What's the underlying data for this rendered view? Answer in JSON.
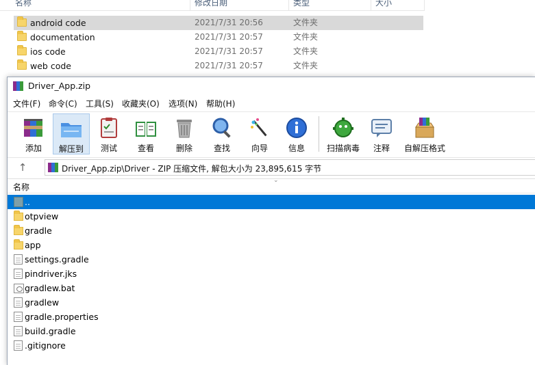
{
  "explorer": {
    "headers": {
      "name": "名称",
      "date": "修改日期",
      "type": "类型",
      "size": "大小"
    },
    "rows": [
      {
        "name": "android code",
        "date": "2021/7/31 20:56",
        "type": "文件夹"
      },
      {
        "name": "documentation",
        "date": "2021/7/31 20:57",
        "type": "文件夹"
      },
      {
        "name": "ios code",
        "date": "2021/7/31 20:57",
        "type": "文件夹"
      },
      {
        "name": "web code",
        "date": "2021/7/31 20:57",
        "type": "文件夹"
      }
    ]
  },
  "rar": {
    "title": "Driver_App.zip",
    "menu": [
      "文件(F)",
      "命令(C)",
      "工具(S)",
      "收藏夹(O)",
      "选项(N)",
      "帮助(H)"
    ],
    "toolbar": {
      "add": "添加",
      "extract": "解压到",
      "test": "测试",
      "view": "查看",
      "delete": "删除",
      "find": "查找",
      "wizard": "向导",
      "info": "信息",
      "scan": "扫描病毒",
      "comment": "注释",
      "sfx": "自解压格式"
    },
    "path": "Driver_App.zip\\Driver - ZIP 压缩文件, 解包大小为 23,895,615 字节",
    "list_header": "名称",
    "files": [
      {
        "name": "..",
        "kind": "updir"
      },
      {
        "name": "otpview",
        "kind": "folder"
      },
      {
        "name": "gradle",
        "kind": "folder"
      },
      {
        "name": "app",
        "kind": "folder"
      },
      {
        "name": "settings.gradle",
        "kind": "doc"
      },
      {
        "name": "pindriver.jks",
        "kind": "doc"
      },
      {
        "name": "gradlew.bat",
        "kind": "bat"
      },
      {
        "name": "gradlew",
        "kind": "doc"
      },
      {
        "name": "gradle.properties",
        "kind": "doc"
      },
      {
        "name": "build.gradle",
        "kind": "doc"
      },
      {
        "name": ".gitignore",
        "kind": "doc"
      }
    ]
  },
  "colors": {
    "selection": "#0078d7",
    "explorer_selection": "#d9d9d9",
    "folder": "#f7d56b"
  }
}
